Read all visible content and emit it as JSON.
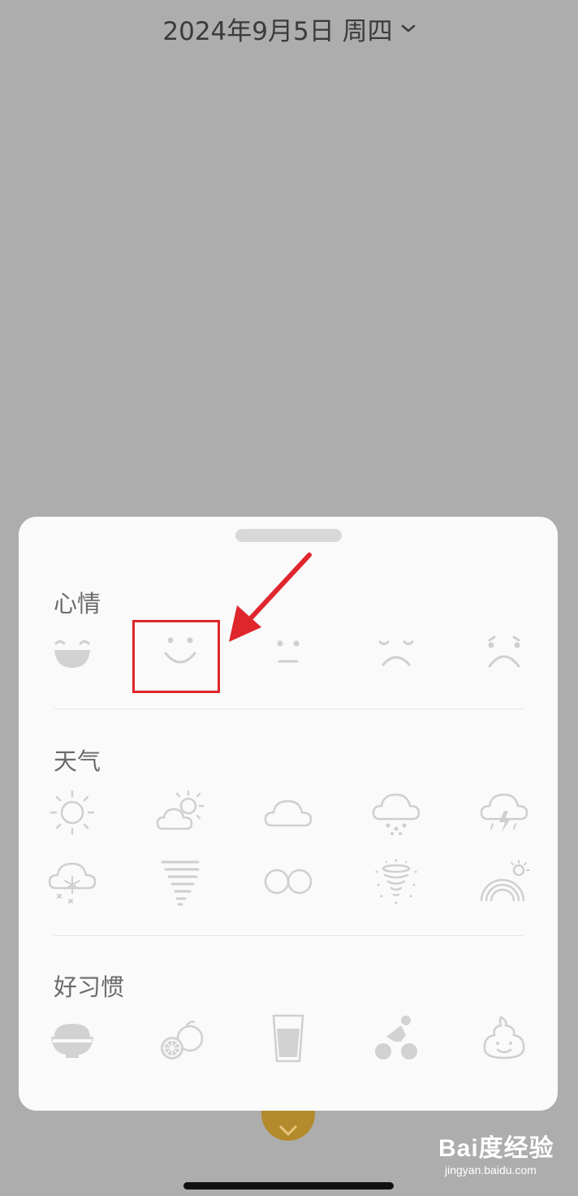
{
  "header": {
    "date_label": "2024年9月5日 周四"
  },
  "sheet": {
    "sections": [
      {
        "title": "心情",
        "icons": [
          "big-smile-icon",
          "smile-icon",
          "neutral-face-icon",
          "unhappy-face-icon",
          "sad-face-icon"
        ]
      },
      {
        "title": "天气",
        "icons": [
          "sun-icon",
          "partly-cloudy-icon",
          "cloud-icon",
          "rain-icon",
          "thunderstorm-icon",
          "snow-icon",
          "wind-icon",
          "fog-icon",
          "tornado-icon",
          "rainbow-icon"
        ]
      },
      {
        "title": "好习惯",
        "icons": [
          "rice-bowl-icon",
          "fruit-icon",
          "water-glass-icon",
          "cycling-icon",
          "poop-icon"
        ]
      }
    ],
    "highlighted_icon": "smile-icon"
  },
  "watermark": {
    "main": "Bai度经验",
    "sub": "jingyan.baidu.com"
  },
  "colors": {
    "background": "#adadad",
    "sheet": "#fafafa",
    "icon": "#c9c9c9",
    "highlight": "#e0262d",
    "fab": "#b38a2c"
  }
}
